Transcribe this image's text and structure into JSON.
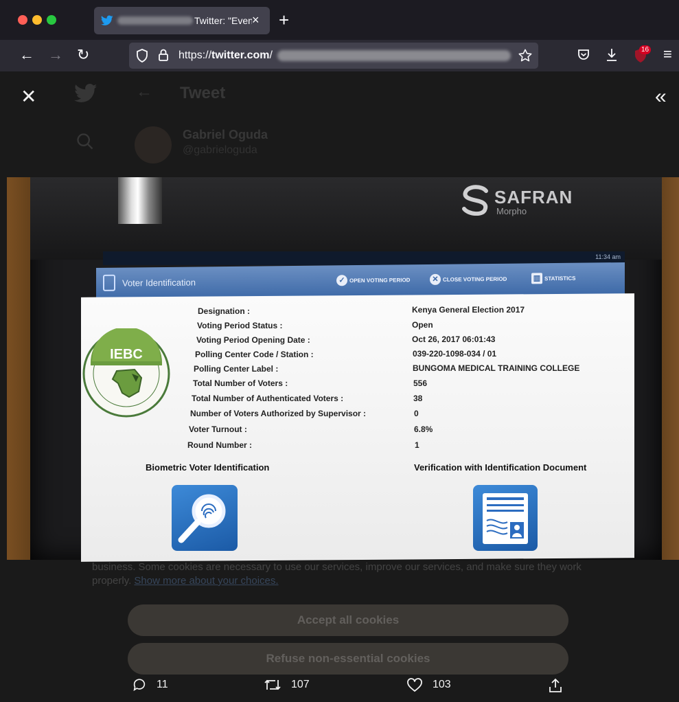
{
  "browser": {
    "tab_title": "Twitter: \"Even",
    "tab_close": "×",
    "new_tab": "+",
    "url_prefix": "https://",
    "url_domain": "twitter.com",
    "url_suffix": "/",
    "extension_badge": "16"
  },
  "tweet_view": {
    "header": "Tweet",
    "author_name": "Gabriel Oguda",
    "author_handle": "@gabrieloguda",
    "replies": "11",
    "retweets": "107",
    "likes": "103"
  },
  "cookie_banner": {
    "text": "business. Some cookies are necessary to use our services, improve our services, and make sure they work properly.",
    "link": "Show more about your choices.",
    "accept_label": "Accept all cookies",
    "refuse_label": "Refuse non-essential cookies"
  },
  "photo": {
    "brand": "SAFRAN",
    "brand_sub": "Morpho",
    "status_time": "11:34 am",
    "app_title": "Voter Identification",
    "app_buttons": [
      "OPEN VOTING PERIOD",
      "CLOSE VOTING PERIOD",
      "STATISTICS"
    ],
    "logo_text": "IEBC",
    "fields": [
      {
        "label": "Designation :",
        "value": "Kenya General Election 2017"
      },
      {
        "label": "Voting Period Status :",
        "value": "Open"
      },
      {
        "label": "Voting Period Opening Date :",
        "value": "Oct 26, 2017 06:01:43"
      },
      {
        "label": "Polling Center Code / Station :",
        "value": "039-220-1098-034 / 01"
      },
      {
        "label": "Polling Center Label :",
        "value": "BUNGOMA MEDICAL TRAINING COLLEGE"
      },
      {
        "label": "Total Number of Voters :",
        "value": "556"
      },
      {
        "label": "Total Number of Authenticated Voters :",
        "value": "38"
      },
      {
        "label": "Number of Voters Authorized by Supervisor :",
        "value": "0"
      },
      {
        "label": "Voter Turnout :",
        "value": "6.8%"
      },
      {
        "label": "Round Number :",
        "value": "1"
      }
    ],
    "biometric_label": "Biometric Voter Identification",
    "document_label": "Verification with Identification Document"
  }
}
